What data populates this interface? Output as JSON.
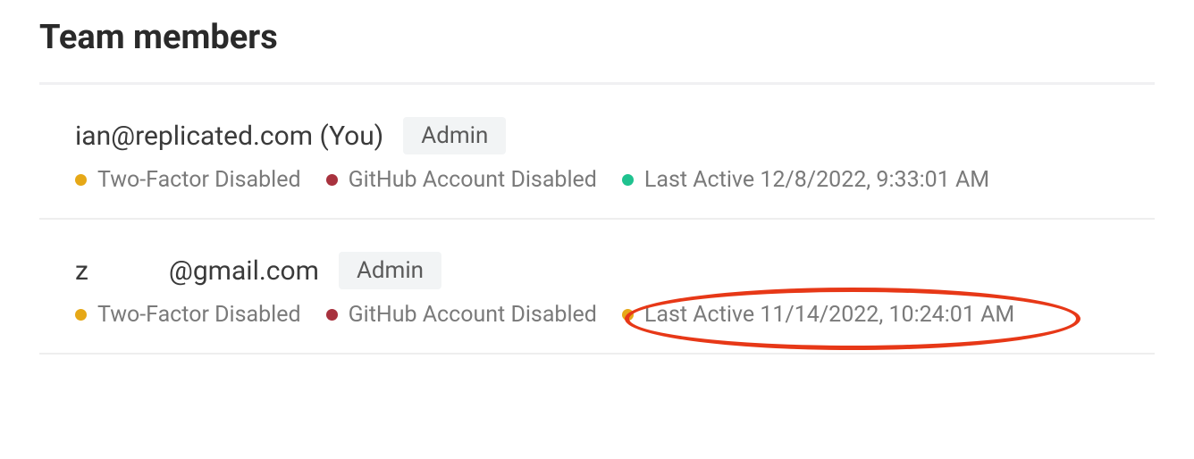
{
  "title": "Team members",
  "members": [
    {
      "email": "ian@replicated.com (You)",
      "role": "Admin",
      "statuses": [
        {
          "dot_color": "orange",
          "label": "Two-Factor Disabled"
        },
        {
          "dot_color": "dark-red",
          "label": "GitHub Account Disabled"
        },
        {
          "dot_color": "green",
          "label": "Last Active 12/8/2022, 9:33:01 AM"
        }
      ]
    },
    {
      "email_prefix": "z",
      "email_suffix": "@gmail.com",
      "role": "Admin",
      "statuses": [
        {
          "dot_color": "orange",
          "label": "Two-Factor Disabled"
        },
        {
          "dot_color": "dark-red",
          "label": "GitHub Account Disabled"
        },
        {
          "dot_color": "orange",
          "label": "Last Active 11/14/2022, 10:24:01 AM"
        }
      ],
      "highlighted_status_index": 2
    }
  ]
}
